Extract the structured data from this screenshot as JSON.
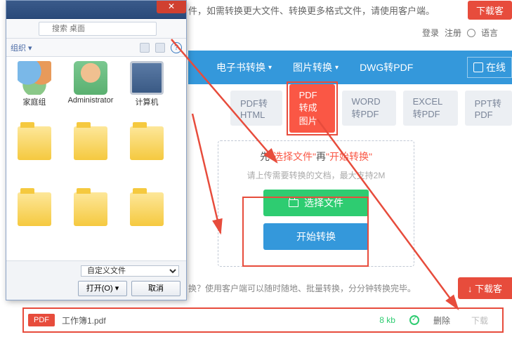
{
  "top": {
    "banner_text": "件，如需转换更大文件、转换更多格式文件，请使用客户端。",
    "download_btn": "下载客"
  },
  "login": {
    "login": "登录",
    "register": "注册",
    "language": "语言"
  },
  "nav": {
    "ebook": "电子书转换",
    "image": "图片转换",
    "dwg": "DWG转PDF",
    "online": "在线"
  },
  "tabs": {
    "html": "PDF转HTML",
    "image": "PDF转成图片",
    "word": "WORD转PDF",
    "excel": "EXCEL转PDF",
    "ppt": "PPT转PDF"
  },
  "upload": {
    "title_pre": "先",
    "title_q1": "\"选择文件\"",
    "title_mid": "再",
    "title_q2": "\"开始转换\"",
    "subtitle": "请上传需要转换的文档，最大支持2M",
    "select_btn": "选择文件",
    "start_btn": "开始转换"
  },
  "bottom": {
    "text": "换？使用客户端可以随时随地、批量转换，分分钟转换完毕。",
    "download_btn": "下载客"
  },
  "file": {
    "badge": "PDF",
    "name": "工作簿1.pdf",
    "size": "8 kb",
    "delete": "删除",
    "download": "下载"
  },
  "dialog": {
    "search_placeholder": "搜索 桌面",
    "items": [
      {
        "label": "家庭组",
        "type": "people"
      },
      {
        "label": "Administrator",
        "type": "admin"
      },
      {
        "label": "计算机",
        "type": "computer"
      },
      {
        "label": "",
        "type": "folder"
      },
      {
        "label": "",
        "type": "folder"
      },
      {
        "label": "",
        "type": "folder"
      },
      {
        "label": "",
        "type": "folder"
      },
      {
        "label": "",
        "type": "folder"
      },
      {
        "label": "",
        "type": "folder"
      }
    ],
    "filter": "自定义文件",
    "open_btn": "打开(O)",
    "cancel_btn": "取消"
  }
}
